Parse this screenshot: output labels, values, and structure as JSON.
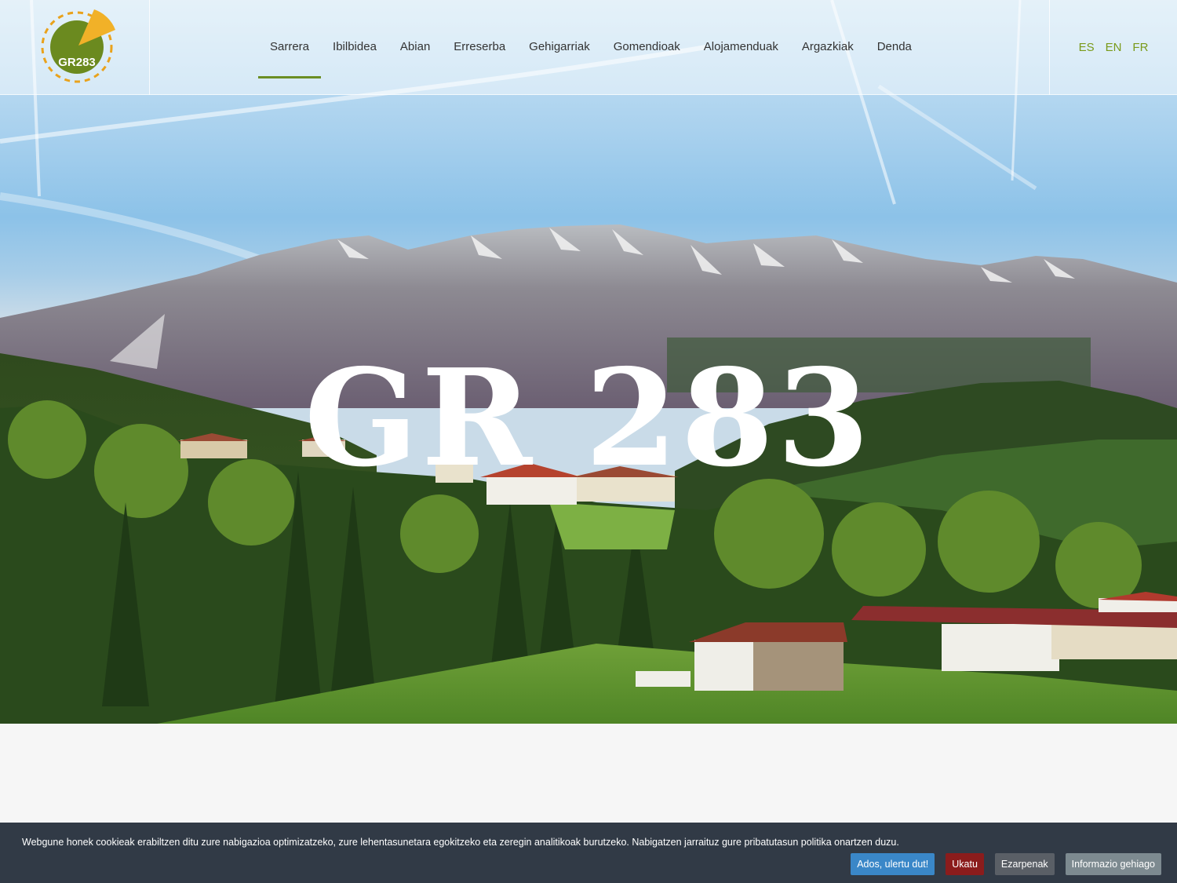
{
  "logo": {
    "text": "GR283"
  },
  "nav": {
    "items": [
      {
        "label": "Sarrera",
        "active": true
      },
      {
        "label": "Ibilbidea"
      },
      {
        "label": "Abian"
      },
      {
        "label": "Erreserba"
      },
      {
        "label": "Gehigarriak"
      },
      {
        "label": "Gomendioak"
      },
      {
        "label": "Alojamenduak"
      },
      {
        "label": "Argazkiak"
      },
      {
        "label": "Denda"
      }
    ]
  },
  "languages": [
    "ES",
    "EN",
    "FR"
  ],
  "hero": {
    "title": "GR 283"
  },
  "cookie": {
    "message": "Webgune honek cookieak erabiltzen ditu zure nabigazioa optimizatzeko, zure lehentasunetara egokitzeko eta zeregin analitikoak burutzeko. Nabigatzen jarraituz gure pribatutasun politika onartzen duzu.",
    "buttons": {
      "accept": "Ados, ulertu dut!",
      "reject": "Ukatu",
      "settings": "Ezarpenak",
      "more": "Informazio gehiago"
    }
  },
  "colors": {
    "accent": "#6b8e23",
    "lang": "#7a9a1a",
    "cookie_bg": "#313a46",
    "accept_btn": "#3a87c8",
    "reject_btn": "#8b1c1c",
    "settings_btn": "#5a5f66",
    "more_btn": "#7d8a90"
  }
}
